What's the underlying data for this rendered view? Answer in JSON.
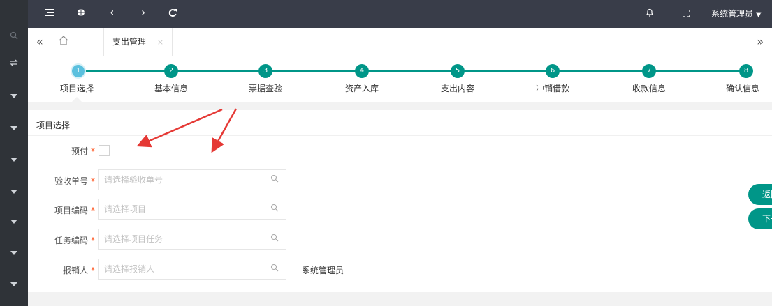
{
  "topbar": {
    "menu_icon": "menu-icon",
    "globe_icon": "globe-icon",
    "back_icon": "‹",
    "forward_icon": "›",
    "refresh_icon": "C",
    "user": "系统管理员",
    "user_caret": "▼"
  },
  "tabs": {
    "left_scroll": "«",
    "right_scroll": "»",
    "active_label": "支出管理",
    "close": "×"
  },
  "steps": [
    {
      "num": "1",
      "label": "项目选择"
    },
    {
      "num": "2",
      "label": "基本信息"
    },
    {
      "num": "3",
      "label": "票据查验"
    },
    {
      "num": "4",
      "label": "资产入库"
    },
    {
      "num": "5",
      "label": "支出内容"
    },
    {
      "num": "6",
      "label": "冲销借款"
    },
    {
      "num": "7",
      "label": "收款信息"
    },
    {
      "num": "8",
      "label": "确认信息"
    }
  ],
  "section": {
    "title": "项目选择"
  },
  "form": {
    "prepay_label": "预付",
    "required": "*",
    "acceptance_label": "验收单号",
    "acceptance_placeholder": "请选择验收单号",
    "project_label": "项目编码",
    "project_placeholder": "请选择项目",
    "task_label": "任务编码",
    "task_placeholder": "请选择项目任务",
    "reimburser_label": "报销人",
    "reimburser_placeholder": "请选择报销人",
    "reimburser_value": "系统管理员"
  },
  "buttons": {
    "back": "返回",
    "next": "下一步"
  },
  "colors": {
    "accent": "#009688",
    "topbar": "#393d49",
    "sidebar": "#2f3338",
    "required": "#ff5722",
    "arrow": "#e53935"
  }
}
